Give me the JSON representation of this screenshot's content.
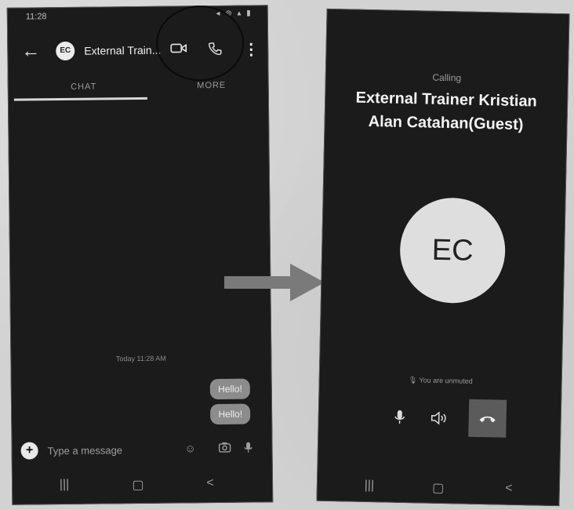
{
  "left_phone": {
    "status": {
      "time": "11:28",
      "icons": "◂ ⊚ ▴ ▮"
    },
    "app_bar": {
      "back_icon": "arrow-left-icon",
      "avatar_initials": "EC",
      "title": "External Train...",
      "video_icon": "video-camera-icon",
      "call_icon": "phone-icon",
      "more_icon": "more-vertical-icon"
    },
    "tabs": [
      "CHAT",
      "MORE"
    ],
    "conversation": {
      "date_label": "Today 11:28 AM",
      "messages": [
        "Hello!",
        "Hello!"
      ]
    },
    "composer": {
      "placeholder": "Type a message",
      "add_icon": "add-icon",
      "emoji_icon": "emoji-icon",
      "camera_icon": "camera-icon",
      "mic_icon": "microphone-icon"
    },
    "nav": {
      "recent": "|||",
      "home": "▢",
      "back": "<"
    }
  },
  "right_phone": {
    "calling_label": "Calling",
    "caller_name": "External Trainer Kristian Alan Catahan(Guest)",
    "avatar_initials": "EC",
    "mute_status": "You are unmuted",
    "controls": {
      "mic_icon": "microphone-icon",
      "speaker_icon": "speaker-icon",
      "end_call_icon": "end-call-icon"
    },
    "nav": {
      "recent": "|||",
      "home": "▢",
      "back": "<"
    }
  },
  "colors": {
    "screen_bg": "#1b1b1b",
    "bubble_bg": "#8c8c8c",
    "end_call_bg": "#5b5b5b",
    "paper": "#d2d2d2"
  }
}
